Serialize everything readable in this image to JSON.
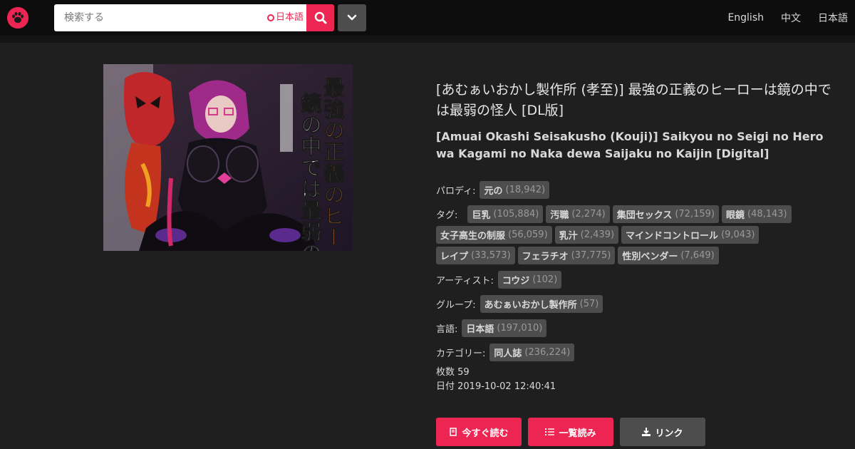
{
  "header": {
    "logo_icon": "cat-paw-icon",
    "search_placeholder": "検索する",
    "search_lang_toggle": "日本語",
    "languages": [
      "English",
      "中文",
      "日本語"
    ]
  },
  "gallery": {
    "title_ja": "[あむぁいおかし製作所 (孝至)] 最強の正義のヒーローは鏡の中では最弱の怪人 [DL版]",
    "title_en": "[Amuai Okashi Seisakusho (Kouji)] Saikyou no Seigi no Hero wa Kagami no Naka dewa Saijaku no Kaijin [Digital]",
    "cover_text": {
      "main_line1": "最強の正義のヒーローは",
      "main_line2": "鏡の中では最弱の怪人"
    },
    "tag_groups": {
      "parody": {
        "label": "パロディ:",
        "tags": [
          {
            "name": "元の",
            "count": "(18,942)"
          }
        ]
      },
      "tags": {
        "label": "タグ:",
        "tags": [
          {
            "name": "巨乳",
            "count": "(105,884)"
          },
          {
            "name": "汚職",
            "count": "(2,274)"
          },
          {
            "name": "集団セックス",
            "count": "(72,159)"
          },
          {
            "name": "眼鏡",
            "count": "(48,143)"
          },
          {
            "name": "女子高生の制服",
            "count": "(56,059)"
          },
          {
            "name": "乳汁",
            "count": "(2,439)"
          },
          {
            "name": "マインドコントロール",
            "count": "(9,043)"
          },
          {
            "name": "レイプ",
            "count": "(33,573)"
          },
          {
            "name": "フェラチオ",
            "count": "(37,775)"
          },
          {
            "name": "性別ベンダー",
            "count": "(7,649)"
          }
        ]
      },
      "artist": {
        "label": "アーティスト:",
        "tags": [
          {
            "name": "コウジ",
            "count": "(102)"
          }
        ]
      },
      "group": {
        "label": "グループ:",
        "tags": [
          {
            "name": "あむぁいおかし製作所",
            "count": "(57)"
          }
        ]
      },
      "language": {
        "label": "言語:",
        "tags": [
          {
            "name": "日本語",
            "count": "(197,010)"
          }
        ]
      },
      "category": {
        "label": "カテゴリー:",
        "tags": [
          {
            "name": "同人誌",
            "count": "(236,224)"
          }
        ]
      }
    },
    "pages_text": "枚数 59",
    "date_text": "日付 2019-10-02 12:40:41",
    "buttons": {
      "read_now": "今すぐ読む",
      "list_read": "一覧読み",
      "link": "リンク"
    }
  },
  "colors": {
    "accent": "#ed2553",
    "background": "#1f1f1f",
    "topbar": "#0d0d0d",
    "tag_bg": "#4d4d4d"
  }
}
